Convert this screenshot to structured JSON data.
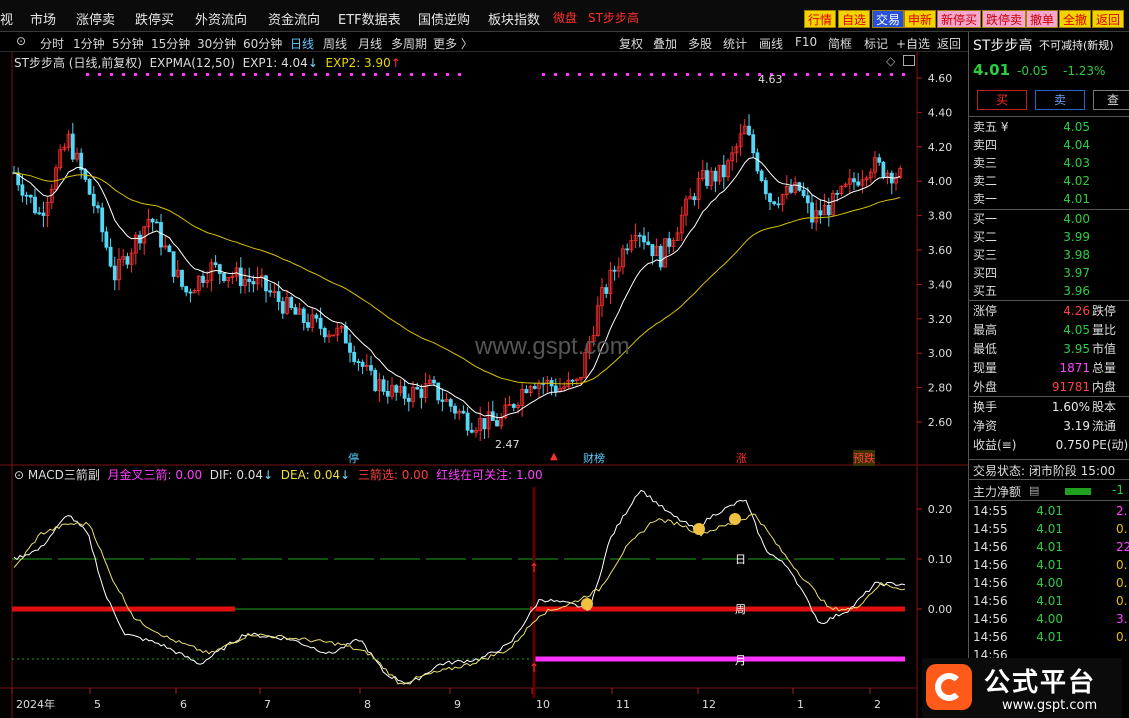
{
  "colors": {
    "up": "#ff3030",
    "down": "#54d6f5",
    "ma_fast": "#ffffff",
    "ma_slow": "#d7c200",
    "dif": "#ffffff",
    "dea": "#e8e070",
    "magenta": "#ff33ff",
    "green": "#1fa01f"
  },
  "topbar": {
    "menu": [
      "视",
      "市场",
      "涨停卖",
      "跌停买",
      "外资流向",
      "资金流向",
      "ETF数据表",
      "国债逆购",
      "板块指数"
    ],
    "red_items": [
      "微盘",
      "ST步步高"
    ],
    "buttons": [
      "行情",
      "自选",
      "交易",
      "申新",
      "新停买",
      "跌停卖",
      "撤单",
      "全撤",
      "返回"
    ]
  },
  "toolbar": {
    "periods": [
      "分时",
      "1分钟",
      "5分钟",
      "15分钟",
      "30分钟",
      "60分钟",
      "日线",
      "周线",
      "月线",
      "多周期",
      "更多 〉"
    ],
    "selected": "日线",
    "actions": [
      "复权",
      "叠加",
      "多股",
      "统计",
      "画线",
      "F10",
      "简框",
      "标记",
      "+自选",
      "返回"
    ]
  },
  "main_chart": {
    "title": "ST步步高 (日线,前复权)",
    "indicator": "EXPMA(12,50)",
    "exp1_label": "EXP1: 4.04",
    "exp1_arrow": "↓",
    "exp2_label": "EXP2: 3.90",
    "exp2_arrow": "↑",
    "y_ticks": [
      "4.60",
      "4.40",
      "4.20",
      "4.00",
      "3.80",
      "3.60",
      "3.40",
      "3.20",
      "3.00",
      "2.80",
      "2.60"
    ],
    "high_label": "4.63",
    "low_label": "2.47",
    "watermark": "www.gspt.com",
    "markers": [
      "停",
      "财榜",
      "涨",
      "预跌"
    ]
  },
  "sub_chart": {
    "name": "MACD三箭副",
    "l1": "月金叉三箭: 0.00",
    "l2": "DIF: 0.04",
    "l2_arrow": "↓",
    "l3": "DEA: 0.04",
    "l3_arrow": "↓",
    "l4": "三箭选: 0.00",
    "l5": "红线在可关注: 1.00",
    "y_ticks": [
      "0.20",
      "0.10",
      "0.00"
    ],
    "line_labels": [
      "日",
      "周",
      "月"
    ]
  },
  "x_axis": [
    "2024年",
    "5",
    "6",
    "7",
    "8",
    "9",
    "10",
    "11",
    "12",
    "1",
    "2"
  ],
  "quote": {
    "name": "ST步步高",
    "status": "不可减持(新规)",
    "price": "4.01",
    "change": "-0.05",
    "pct": "-1.23%",
    "buy_btn": "买",
    "sell_btn": "卖",
    "query_btn": "查",
    "asks": [
      [
        "卖五 ¥",
        "4.05"
      ],
      [
        "卖四",
        "4.04"
      ],
      [
        "卖三",
        "4.03"
      ],
      [
        "卖二",
        "4.02"
      ],
      [
        "卖一",
        "4.01"
      ]
    ],
    "bids": [
      [
        "买一",
        "4.00"
      ],
      [
        "买二",
        "3.99"
      ],
      [
        "买三",
        "3.98"
      ],
      [
        "买四",
        "3.97"
      ],
      [
        "买五",
        "3.96"
      ]
    ],
    "stats": [
      [
        "涨停",
        "4.26",
        "跌停"
      ],
      [
        "最高",
        "4.05",
        "量比"
      ],
      [
        "最低",
        "3.95",
        "市值"
      ],
      [
        "现量",
        "1871",
        "总量"
      ],
      [
        "外盘",
        "91781",
        "内盘"
      ]
    ],
    "stats2": [
      [
        "换手",
        "1.60%",
        "股本"
      ],
      [
        "净资",
        "3.19",
        "流通"
      ],
      [
        "收益(≡)",
        "0.750",
        "PE(动)"
      ]
    ],
    "trade_status": "交易状态: 闭市阶段 15:00",
    "main_flow": "主力净额",
    "main_flow_value": "-1",
    "ticks": [
      [
        "14:55",
        "4.01",
        "2."
      ],
      [
        "14:55",
        "4.01",
        "0."
      ],
      [
        "14:56",
        "4.01",
        "22."
      ],
      [
        "14:56",
        "4.01",
        "0."
      ],
      [
        "14:56",
        "4.00",
        "0."
      ],
      [
        "14:56",
        "4.01",
        "0."
      ],
      [
        "14:56",
        "4.00",
        "3."
      ],
      [
        "14:56",
        "4.01",
        "0."
      ],
      [
        "14:56",
        "",
        ""
      ]
    ]
  },
  "logo": {
    "text": "公式平台",
    "url": "www.gspt.com"
  }
}
